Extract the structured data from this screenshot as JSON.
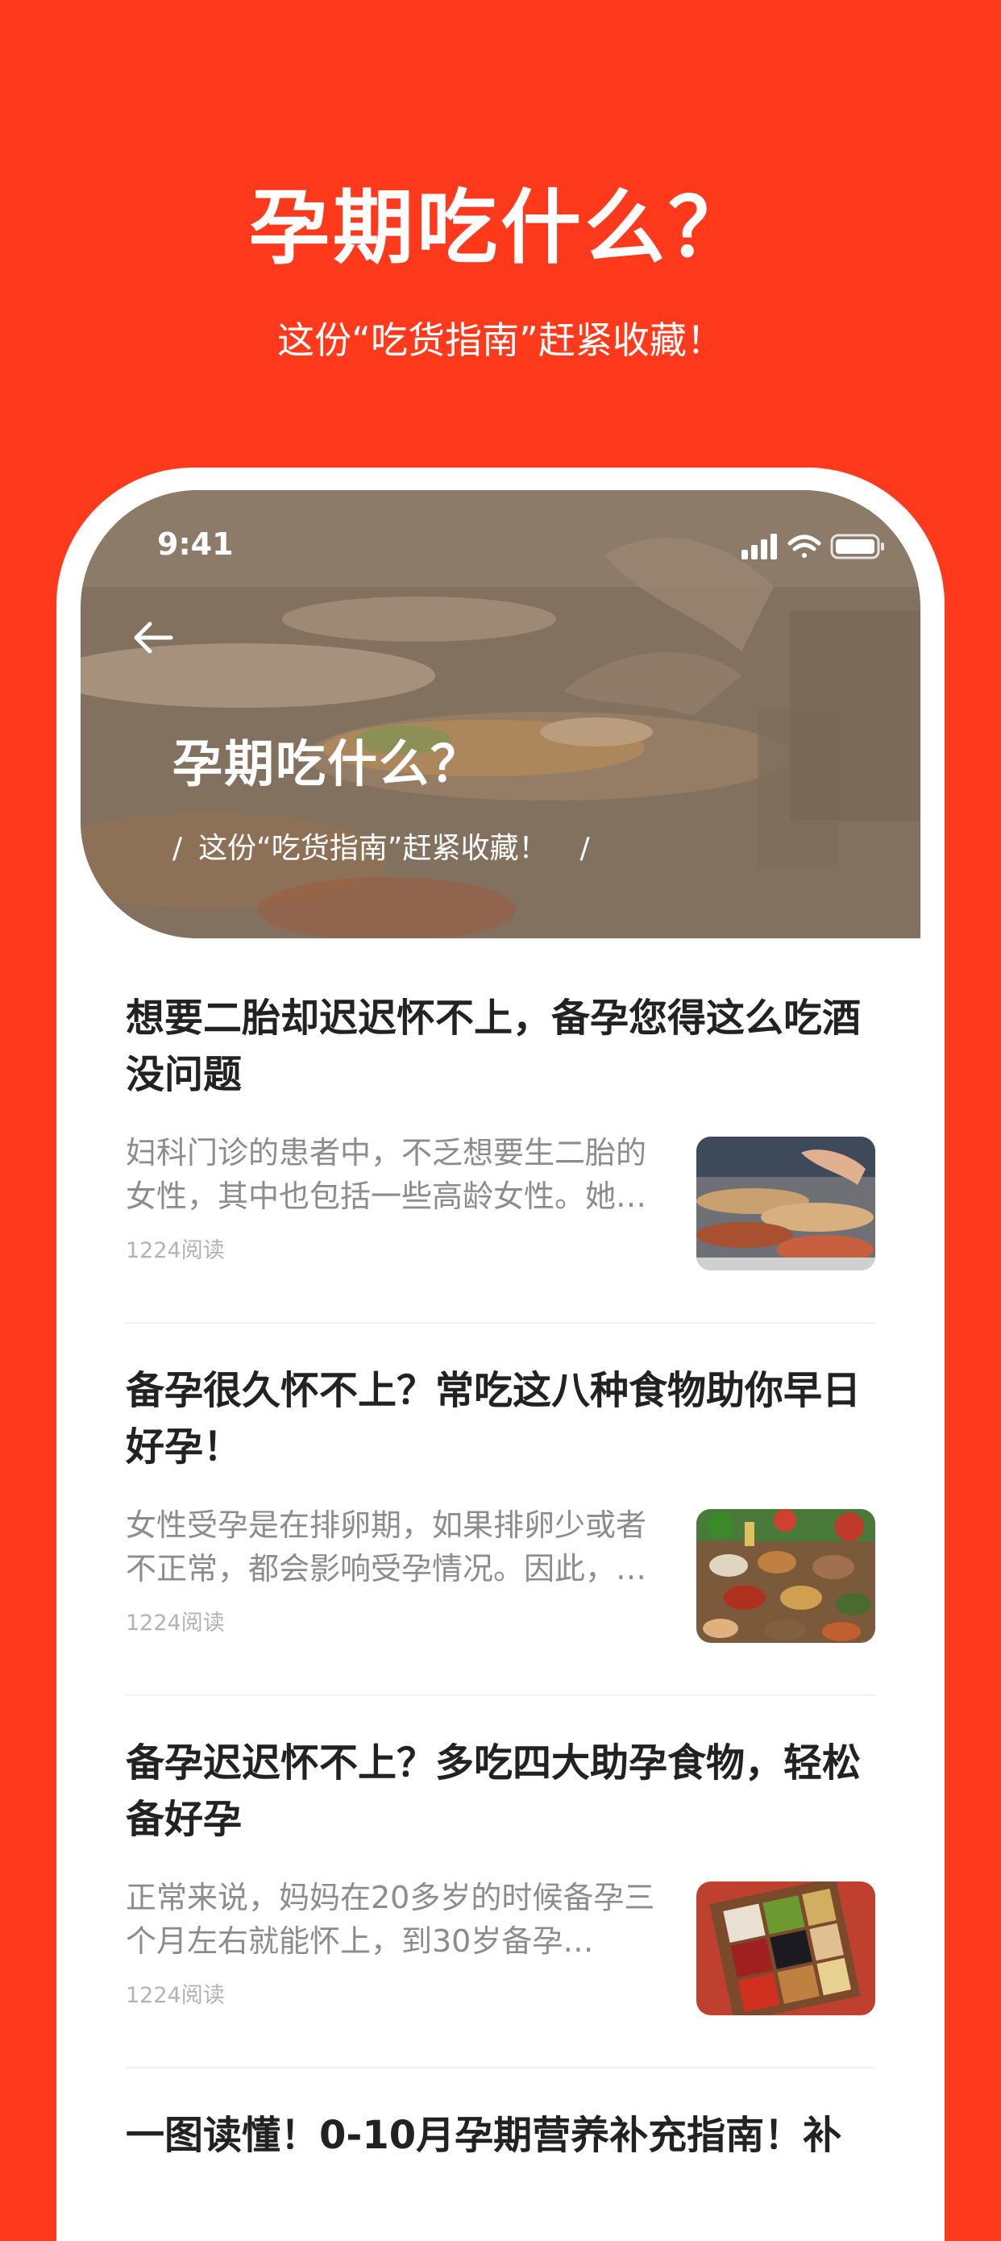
{
  "promo": {
    "title": "孕期吃什么？",
    "subtitle": "这份“吃货指南”赶紧收藏！"
  },
  "status_bar": {
    "time": "9:41",
    "icons": [
      "signal-icon",
      "wifi-icon",
      "battery-icon"
    ]
  },
  "hero": {
    "title": "孕期吃什么？",
    "slash": "/",
    "subtitle": "这份“吃货指南”赶紧收藏！",
    "back_icon": "back-arrow-icon"
  },
  "articles": [
    {
      "title": "想要二胎却迟迟怀不上，备孕您得这么吃酒没问题",
      "summary": "妇科门诊的患者中，不乏想要生二胎的女性，其中也包括一些高龄女性。她…",
      "reads": "1224阅读"
    },
    {
      "title": "备孕很久怀不上？常吃这八种食物助你早日好孕！",
      "summary": "女性受孕是在排卵期，如果排卵少或者不正常，都会影响受孕情况。因此，…",
      "reads": "1224阅读"
    },
    {
      "title": "备孕迟迟怀不上？多吃四大助孕食物，轻松备好孕",
      "summary": "正常来说，妈妈在20多岁的时候备孕三个月左右就能怀上，到30岁备孕…",
      "reads": "1224阅读"
    },
    {
      "title": "一图读懂！0-10月孕期营养补充指南！补"
    }
  ],
  "colors": {
    "brand": "#FF3A1C",
    "title_text": "#222222",
    "summary_text": "#8C8C8C",
    "meta_text": "#B3B3B3"
  }
}
